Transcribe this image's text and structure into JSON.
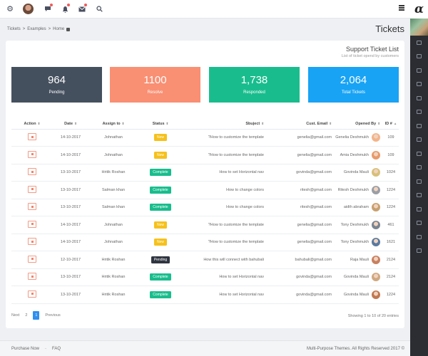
{
  "topbar": {
    "icons": [
      "gear-icon",
      "avatar",
      "chat-icon",
      "bell-icon",
      "mail-icon",
      "search-icon"
    ]
  },
  "breadcrumb": [
    "Tickets",
    "Examples",
    "Home"
  ],
  "breadcrumb_sep": ">",
  "page_title": "Tickets",
  "card": {
    "title": "Support Ticket List",
    "subtitle": "List of ticket opend by customers"
  },
  "stats": [
    {
      "value": "964",
      "label": "Pending",
      "color": "#45505f"
    },
    {
      "value": "1100",
      "label": "Resolve",
      "color": "#f98f73"
    },
    {
      "value": "1,738",
      "label": "Responded",
      "color": "#19bd8d"
    },
    {
      "value": "2,064",
      "label": "Total Tickets",
      "color": "#18a3f5"
    }
  ],
  "table": {
    "headers": [
      "Action",
      "Date",
      "Assign to",
      "Status",
      "Sbuject",
      "Cust. Email",
      "Opened By",
      "ID #"
    ],
    "rows": [
      {
        "date": "14-10-2017",
        "assign": "Johnathan",
        "status": "New",
        "subject": "?How to customize the template",
        "email": "genelia@gmail.com",
        "opened": "Genelia Deshmukh",
        "id": "109"
      },
      {
        "date": "14-10-2017",
        "assign": "Johnathan",
        "status": "New",
        "subject": "?How to customize the template",
        "email": "genelia@gmail.com",
        "opened": "Amia Deshmukh",
        "id": "109"
      },
      {
        "date": "13-10-2017",
        "assign": "Hritik Roshan",
        "status": "Complete",
        "subject": "How to set Horizontal nav",
        "email": "govinda@gmail.com",
        "opened": "Govinda Mauli",
        "id": "1024"
      },
      {
        "date": "13-10-2017",
        "assign": "Salman khan",
        "status": "Complete",
        "subject": "How to change colors",
        "email": "ritesh@gmail.com",
        "opened": "Ritesh Deshmukh",
        "id": "1224"
      },
      {
        "date": "13-10-2017",
        "assign": "Salman khan",
        "status": "Complete",
        "subject": "How to change colors",
        "email": "ritesh@gmail.com",
        "opened": "aidth abraham",
        "id": "1224"
      },
      {
        "date": "14-10-2017",
        "assign": "Johnathan",
        "status": "New",
        "subject": "?How to customize the template",
        "email": "genelia@gmail.com",
        "opened": "Tony Deshmukh",
        "id": "461"
      },
      {
        "date": "14-10-2017",
        "assign": "Johnathan",
        "status": "New",
        "subject": "?How to customize the template",
        "email": "genelia@gmail.com",
        "opened": "Tony Deshmukh",
        "id": "1621"
      },
      {
        "date": "12-10-2017",
        "assign": "Hritik Roshan",
        "status": "Pending",
        "subject": "How this will connect with bahubali",
        "email": "bahubali@gmail.com",
        "opened": "Raja Mauli",
        "id": "2124"
      },
      {
        "date": "13-10-2017",
        "assign": "Hritik Roshan",
        "status": "Complete",
        "subject": "How to set Horizontal nav",
        "email": "govinda@gmail.com",
        "opened": "Govinda Mauli",
        "id": "2124"
      },
      {
        "date": "13-10-2017",
        "assign": "Hritik Roshan",
        "status": "Complete",
        "subject": "How to set Horizontal nav",
        "email": "govinda@gmail.com",
        "opened": "Govinda Mauli",
        "id": "1224"
      }
    ]
  },
  "pagination": {
    "next": "Next",
    "page2": "2",
    "current": "1",
    "previous": "Previous"
  },
  "showing": "Showing 1 to 10 of 20 entries",
  "footer": {
    "links": [
      "Purchase Now",
      "FAQ"
    ],
    "copyright": "Multi-Purpose Themes. All Rights Reserved 2017 ©"
  },
  "sidebar": {
    "logo": "α",
    "item_count": 16
  }
}
